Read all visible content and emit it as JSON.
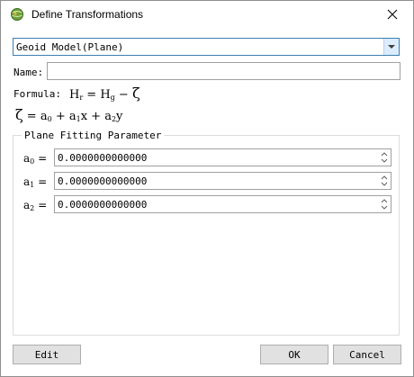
{
  "window": {
    "title": "Define Transformations",
    "close_icon": "close-icon",
    "app_icon": "globe-app-icon"
  },
  "model_select": {
    "value": "Geoid Model(Plane)"
  },
  "name_field": {
    "label": "Name:",
    "value": ""
  },
  "formula": {
    "label": "Formula:"
  },
  "plane_group": {
    "title": "Plane Fitting Parameter",
    "params": [
      {
        "label": "a",
        "sub": "0",
        "value": "0.0000000000000"
      },
      {
        "label": "a",
        "sub": "1",
        "value": "0.0000000000000"
      },
      {
        "label": "a",
        "sub": "2",
        "value": "0.0000000000000"
      }
    ]
  },
  "buttons": {
    "edit": "Edit",
    "ok": "OK",
    "cancel": "Cancel"
  },
  "colors": {
    "combo_border": "#3c7fb1",
    "combo_button": "#dcecfc",
    "button_face": "#e1e1e1",
    "group_border": "#dcdcdc"
  }
}
